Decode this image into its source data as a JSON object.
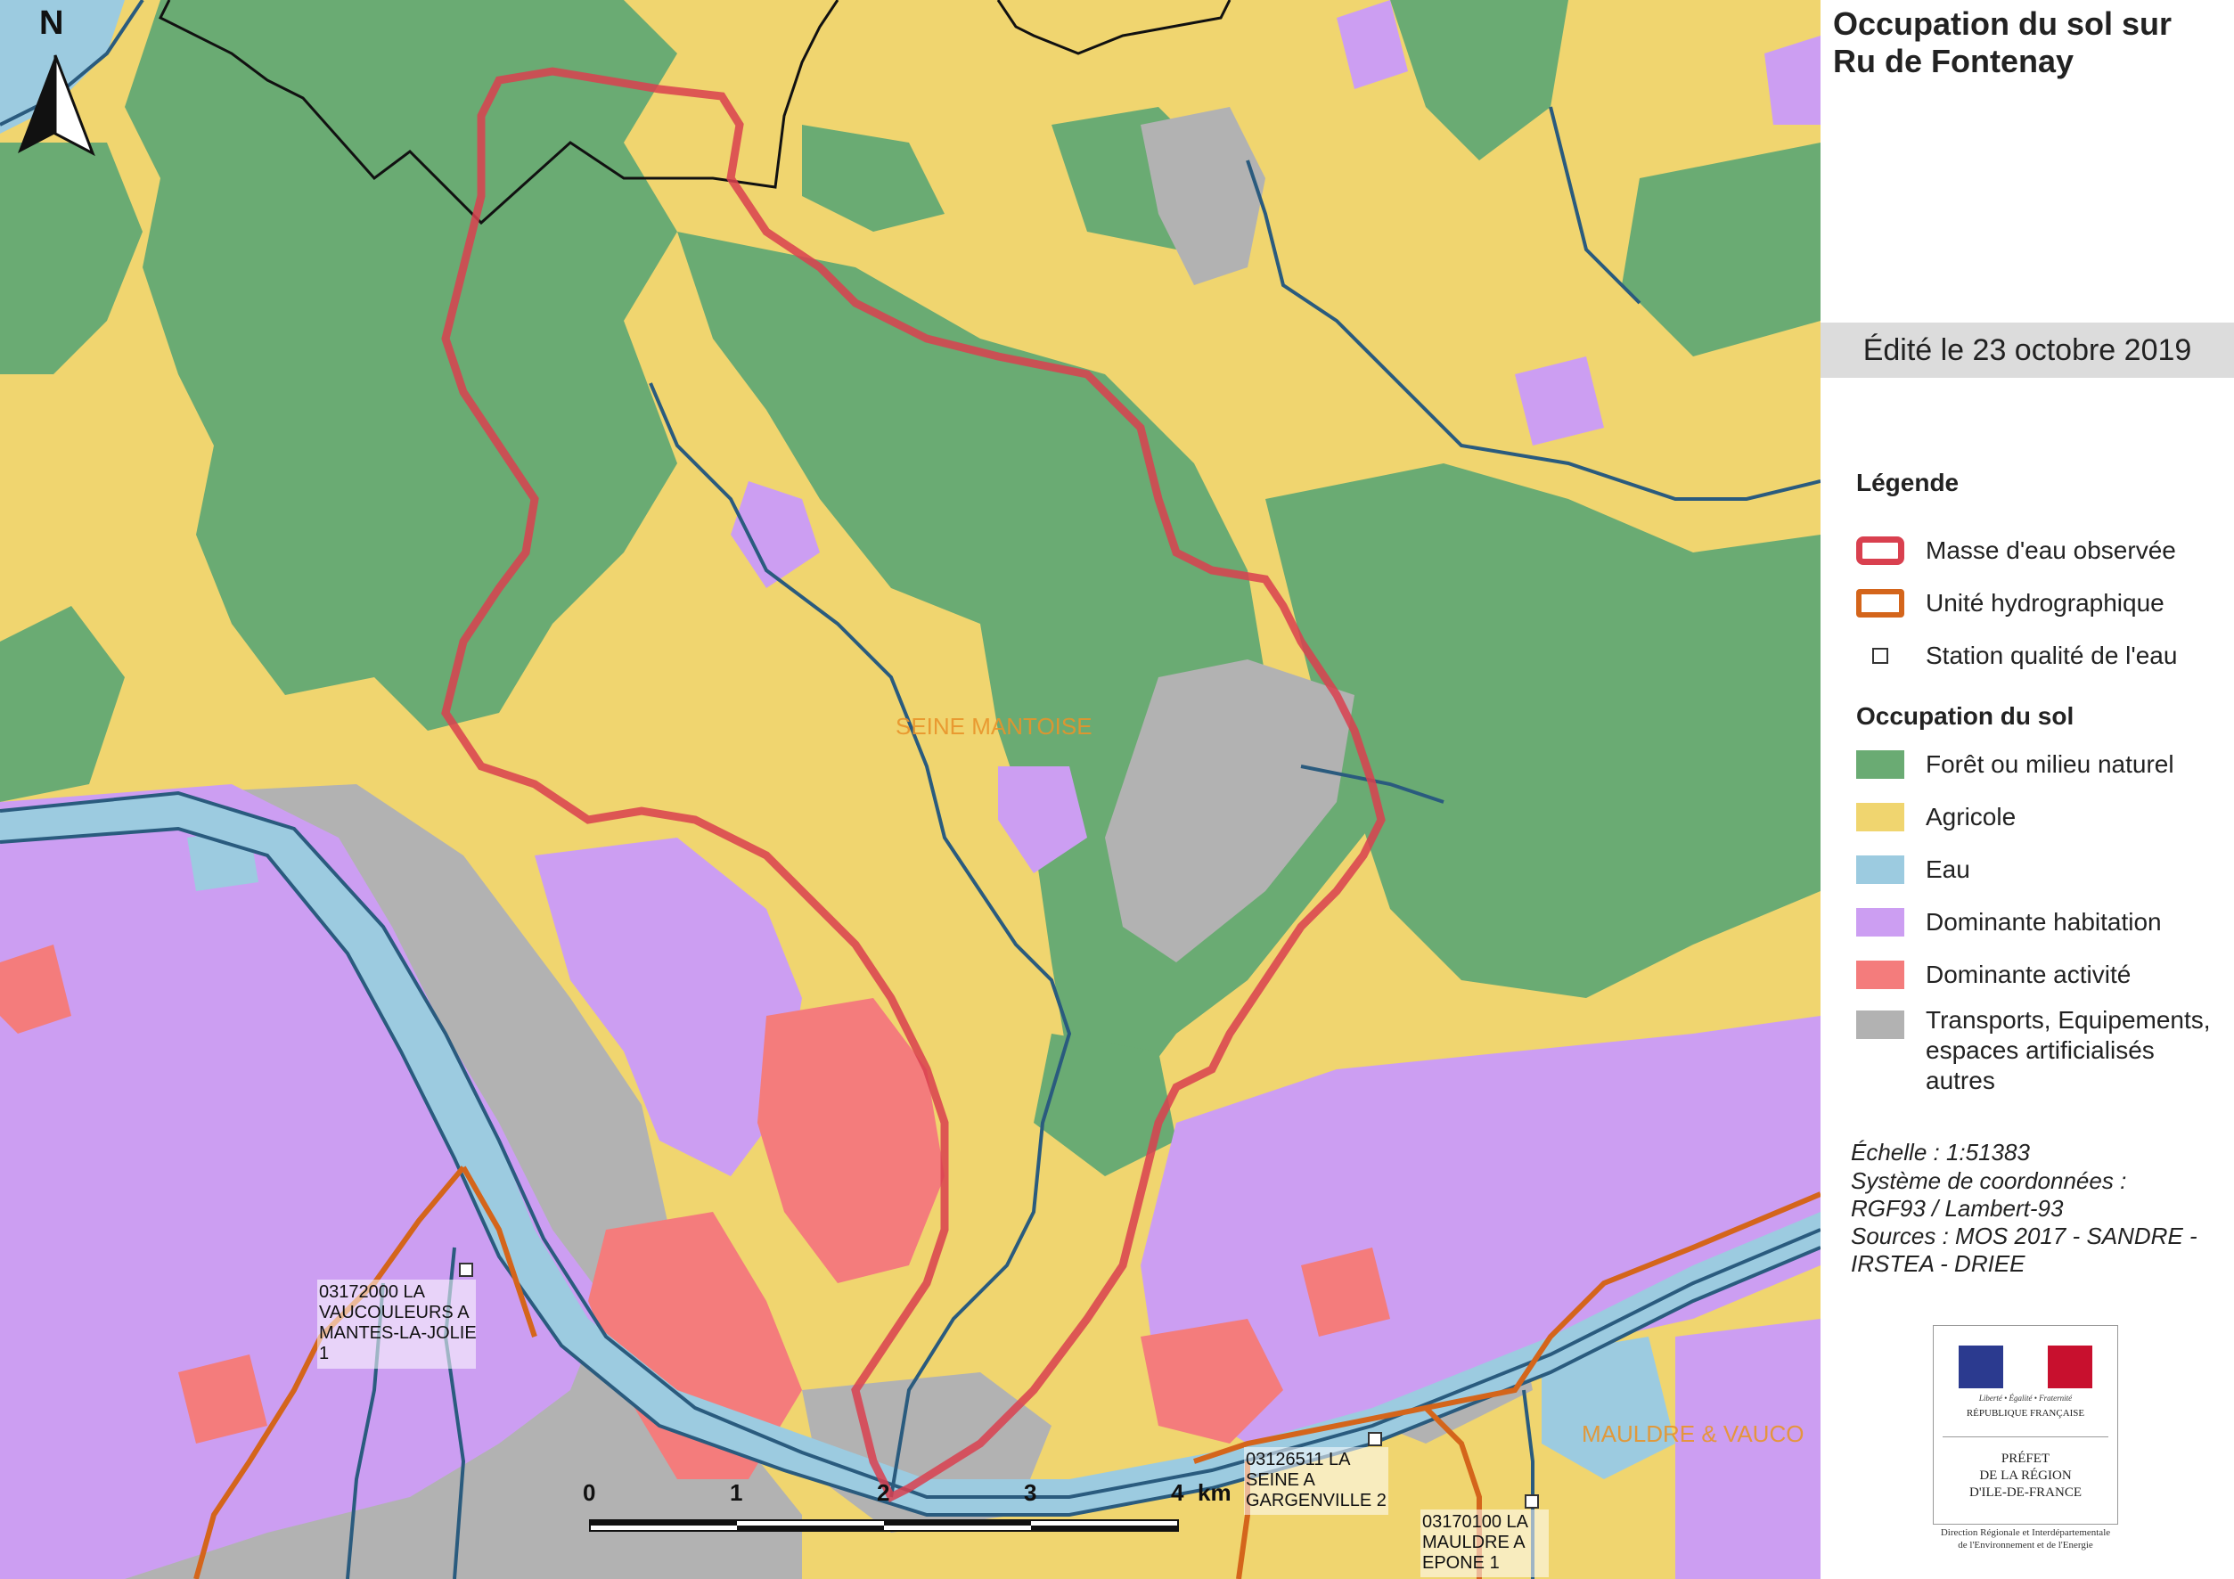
{
  "title": "Occupation du sol sur\nRu de Fontenay",
  "edited": "Édité le 23 octobre 2019",
  "legend": {
    "heading": "Légende",
    "items": [
      {
        "label": "Masse d'eau observée",
        "icon": "red-outline-line"
      },
      {
        "label": "Unité hydrographique",
        "icon": "orange-outline-line"
      },
      {
        "label": "Station qualité de l'eau",
        "icon": "small-square"
      }
    ],
    "landuse_heading": "Occupation du sol",
    "landuse": [
      {
        "label": "Forêt ou milieu naturel",
        "color": "#6aab73"
      },
      {
        "label": "Agricole",
        "color": "#f0d56f"
      },
      {
        "label": "Eau",
        "color": "#9ccbe0"
      },
      {
        "label": "Dominante habitation",
        "color": "#cc9ef2"
      },
      {
        "label": "Dominante activité",
        "color": "#f47c7c"
      },
      {
        "label": "Transports, Equipements,\nespaces artificialisés\n autres",
        "color": "#b2b2b2"
      }
    ]
  },
  "meta": {
    "scale": "Échelle :  1:51383",
    "crs_1": "Système de coordonnées :",
    "crs_2": "RGF93 / Lambert-93",
    "sources_1": "Sources : MOS 2017 - SANDRE -",
    "sources_2": "IRSTEA - DRIEE"
  },
  "logo": {
    "motto": "Liberté • Égalité • Fraternité",
    "republic": "RÉPUBLIQUE FRANÇAISE",
    "prefet": "PRÉFET\nDE LA RÉGION\nD'ILE-DE-FRANCE",
    "flag_colors": [
      "#2b3a8f",
      "#ffffff",
      "#c8102e"
    ]
  },
  "direction": "Direction Régionale et Interdépartementale\nde l'Environnement et de l'Energie",
  "map": {
    "north": "N",
    "area_labels": [
      "SEINE MANTOISE",
      "MAULDRE & VAUCO"
    ],
    "scalebar": {
      "ticks": [
        "0",
        "1",
        "2",
        "3",
        "4"
      ],
      "unit": "km"
    },
    "stations": [
      {
        "lines": [
          "03172000   LA",
          "VAUCOULEURS A",
          "MANTES-LA-JOLIE",
          "1"
        ]
      },
      {
        "lines": [
          "03126511   LA",
          "SEINE A",
          "GARGENVILLE 2"
        ]
      },
      {
        "lines": [
          "03170100   LA",
          "MAULDRE A",
          "EPONE 1"
        ]
      }
    ],
    "colors": {
      "forest": "#6aab73",
      "agri": "#f0d56f",
      "water": "#9ccbe0",
      "housing": "#cc9ef2",
      "activity": "#f47c7c",
      "transport": "#b2b2b2",
      "river": "#2a5b7e",
      "waterbody": "#d9404f",
      "hydro_unit": "#d4651b"
    }
  }
}
